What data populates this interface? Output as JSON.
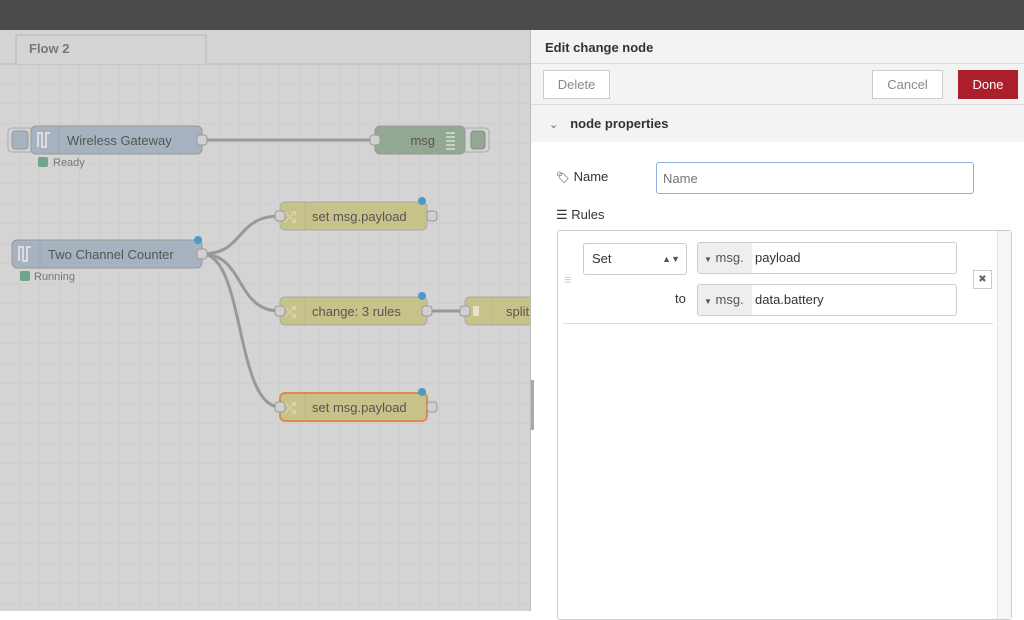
{
  "workspace": {
    "tab": "Flow 2"
  },
  "nodes": [
    {
      "label": "Wireless Gateway",
      "status": "Ready",
      "color": "#a6b2c0"
    },
    {
      "label": "msg",
      "color": "#93a892"
    },
    {
      "label": "Two Channel Counter",
      "status": "Running",
      "color": "#a6b2c0"
    },
    {
      "label": "set msg.payload",
      "color": "#c7c28a"
    },
    {
      "label": "change: 3 rules",
      "color": "#c7c28a"
    },
    {
      "label": "split",
      "color": "#c7c28a"
    },
    {
      "label": "set msg.payload",
      "color": "#c7c28a",
      "selected": true
    }
  ],
  "panel": {
    "title": "Edit change node",
    "delete": "Delete",
    "cancel": "Cancel",
    "done": "Done",
    "done_color": "#ad1f2a",
    "section": "node properties",
    "name_label": "Name",
    "name_placeholder": "Name",
    "name_value": "",
    "rules_label": "Rules",
    "rules": [
      {
        "action": "Set",
        "target_type": "msg.",
        "target": "payload",
        "to_label": "to",
        "source_type": "msg.",
        "source": "data.battery"
      }
    ]
  }
}
